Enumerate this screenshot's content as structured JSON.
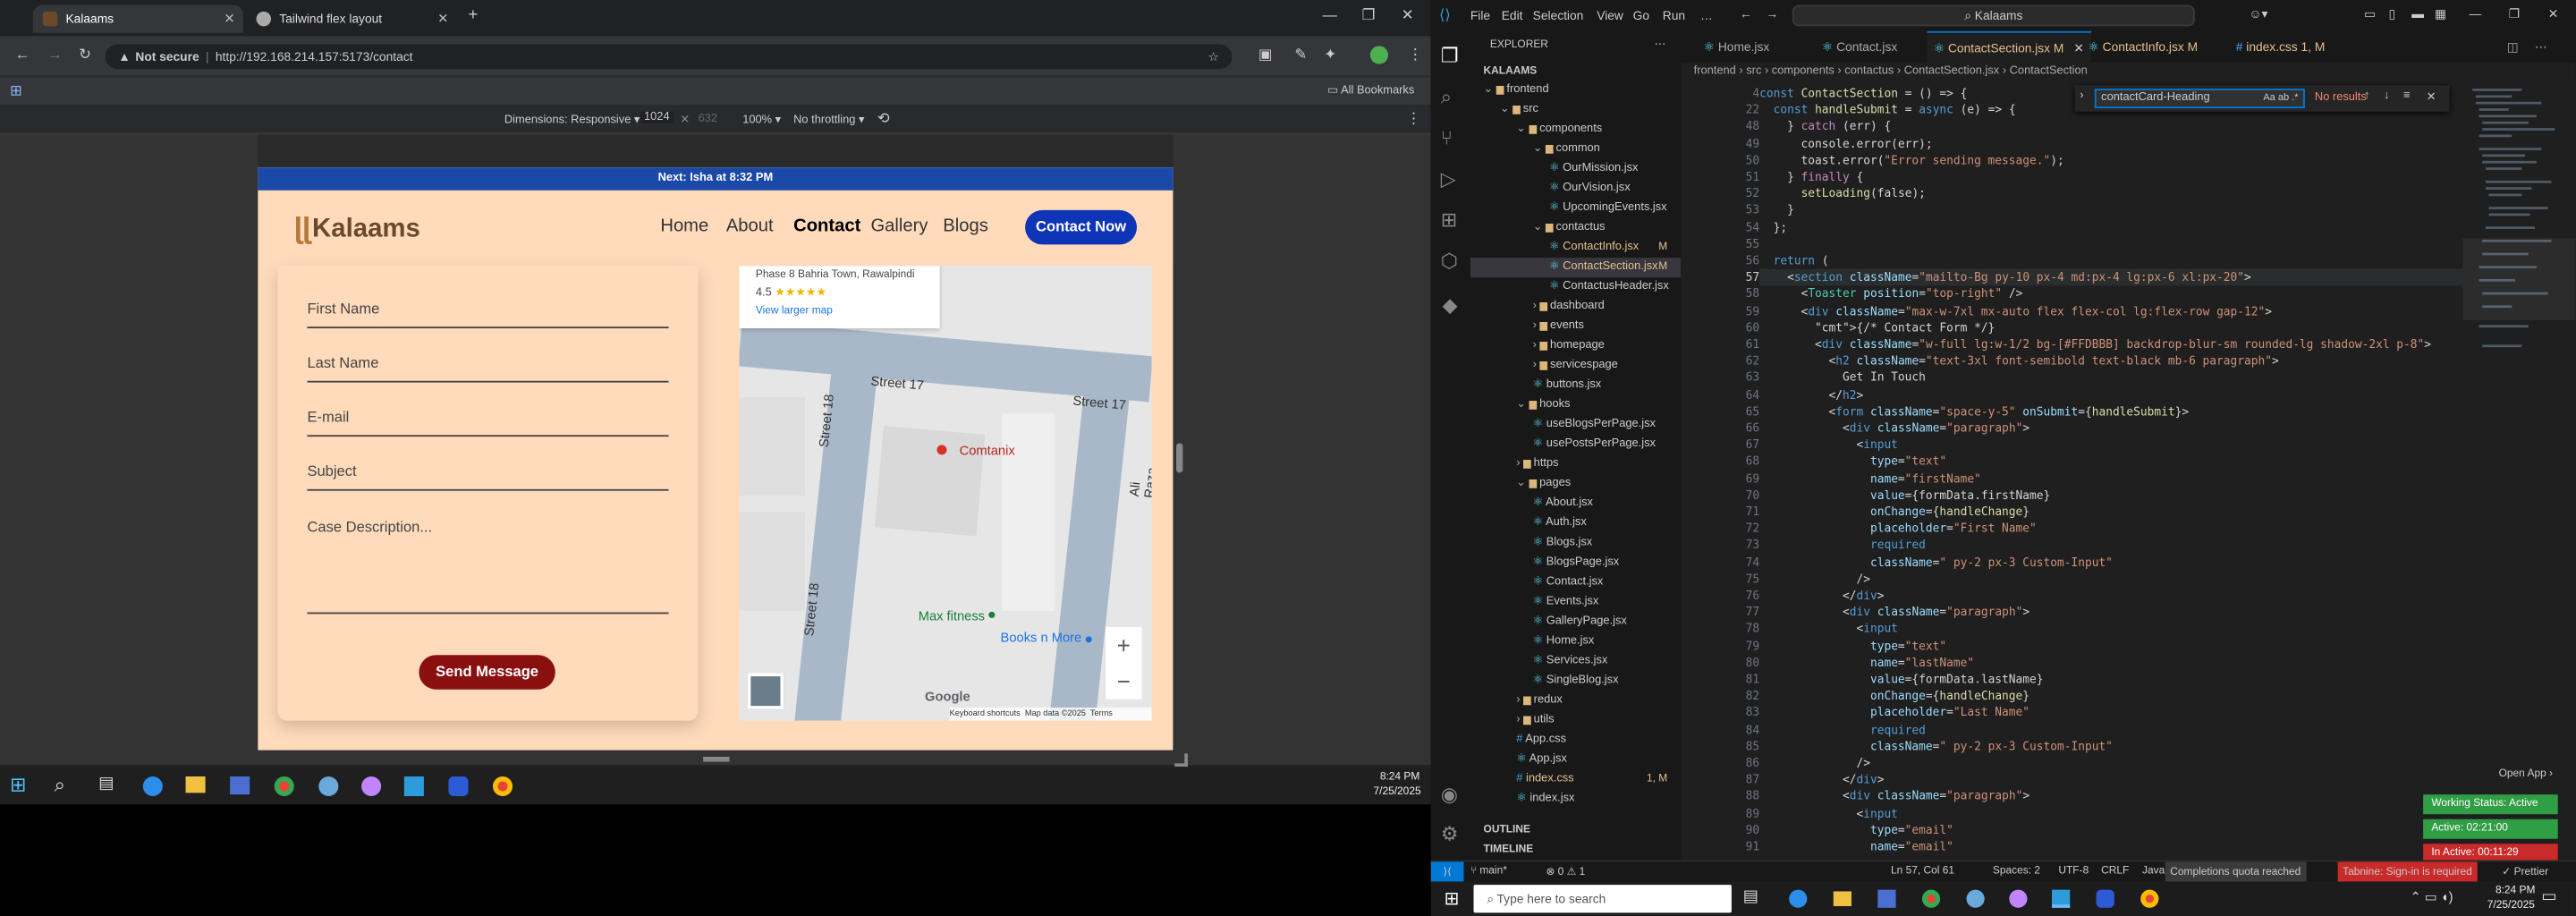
{
  "browser": {
    "tabs": [
      {
        "label": "Kalaams",
        "favicon_color": "#6b4a2a"
      },
      {
        "label": "Tailwind flex layout",
        "favicon_color": "#aaaaaa"
      }
    ],
    "not_secure": "Not secure",
    "url": "http://192.168.214.157:5173/contact",
    "all_bookmarks": "All Bookmarks",
    "devtools": {
      "dimensions": "Dimensions: Responsive ▾",
      "width": "1024",
      "height": "632",
      "zoom": "100% ▾",
      "throttle": "No throttling ▾"
    }
  },
  "site": {
    "announcement": "Next: Isha at 8:32 PM",
    "logo": "Kalaams",
    "nav": [
      "Home",
      "About",
      "Contact",
      "Gallery",
      "Blogs"
    ],
    "contact_button": "Contact Now",
    "form": {
      "fields": [
        "First Name",
        "Last Name",
        "E-mail",
        "Subject",
        "Case Description..."
      ],
      "submit": "Send Message"
    },
    "map": {
      "address": "Phase 8 Bahria Town, Rawalpindi",
      "rating": "4.5",
      "stars": "★★★★★",
      "larger_map": "View larger map",
      "labels": {
        "street1": "Street 17",
        "street2": "Street 17",
        "street3": "Street 18",
        "street4": "Street 18",
        "place": "Comtanix",
        "gym": "Max fitness",
        "books": "Books n More",
        "ali": "Ali Raza"
      },
      "google": "Google",
      "footer": [
        "Keyboard shortcuts",
        "Map data ©2025",
        "Terms"
      ]
    }
  },
  "taskbar_left": {
    "time": "8:24 PM",
    "date": "7/25/2025"
  },
  "vscode": {
    "menu": [
      "File",
      "Edit",
      "Selection",
      "View",
      "Go",
      "Run",
      "…"
    ],
    "search": "Kalaams",
    "explorer_title": "EXPLORER",
    "root": "KALAAMS",
    "tree": [
      {
        "label": "frontend",
        "indent": 0,
        "type": "folder",
        "open": true
      },
      {
        "label": "src",
        "indent": 1,
        "type": "folder",
        "open": true
      },
      {
        "label": "components",
        "indent": 2,
        "type": "folder",
        "open": true
      },
      {
        "label": "common",
        "indent": 3,
        "type": "folder",
        "open": true
      },
      {
        "label": "OurMission.jsx",
        "indent": 4,
        "type": "file"
      },
      {
        "label": "OurVision.jsx",
        "indent": 4,
        "type": "file"
      },
      {
        "label": "UpcomingEvents.jsx",
        "indent": 4,
        "type": "file"
      },
      {
        "label": "contactus",
        "indent": 3,
        "type": "folder",
        "open": true
      },
      {
        "label": "ContactInfo.jsx",
        "indent": 4,
        "type": "file",
        "mod": "M"
      },
      {
        "label": "ContactSection.jsx",
        "indent": 4,
        "type": "file",
        "mod": "M",
        "selected": true
      },
      {
        "label": "ContactusHeader.jsx",
        "indent": 4,
        "type": "file"
      },
      {
        "label": "dashboard",
        "indent": 3,
        "type": "folder"
      },
      {
        "label": "events",
        "indent": 3,
        "type": "folder"
      },
      {
        "label": "homepage",
        "indent": 3,
        "type": "folder"
      },
      {
        "label": "servicespage",
        "indent": 3,
        "type": "folder"
      },
      {
        "label": "buttons.jsx",
        "indent": 3,
        "type": "file"
      },
      {
        "label": "hooks",
        "indent": 2,
        "type": "folder",
        "open": true
      },
      {
        "label": "useBlogsPerPage.jsx",
        "indent": 3,
        "type": "file"
      },
      {
        "label": "usePostsPerPage.jsx",
        "indent": 3,
        "type": "file"
      },
      {
        "label": "https",
        "indent": 2,
        "type": "folder"
      },
      {
        "label": "pages",
        "indent": 2,
        "type": "folder",
        "open": true
      },
      {
        "label": "About.jsx",
        "indent": 3,
        "type": "file"
      },
      {
        "label": "Auth.jsx",
        "indent": 3,
        "type": "file"
      },
      {
        "label": "Blogs.jsx",
        "indent": 3,
        "type": "file"
      },
      {
        "label": "BlogsPage.jsx",
        "indent": 3,
        "type": "file"
      },
      {
        "label": "Contact.jsx",
        "indent": 3,
        "type": "file"
      },
      {
        "label": "Events.jsx",
        "indent": 3,
        "type": "file"
      },
      {
        "label": "GalleryPage.jsx",
        "indent": 3,
        "type": "file"
      },
      {
        "label": "Home.jsx",
        "indent": 3,
        "type": "file"
      },
      {
        "label": "Services.jsx",
        "indent": 3,
        "type": "file"
      },
      {
        "label": "SingleBlog.jsx",
        "indent": 3,
        "type": "file"
      },
      {
        "label": "redux",
        "indent": 2,
        "type": "folder"
      },
      {
        "label": "utils",
        "indent": 2,
        "type": "folder"
      },
      {
        "label": "App.css",
        "indent": 2,
        "type": "file"
      },
      {
        "label": "App.jsx",
        "indent": 2,
        "type": "file"
      },
      {
        "label": "index.css",
        "indent": 2,
        "type": "file",
        "mod": "1, M"
      },
      {
        "label": "index.jsx",
        "indent": 2,
        "type": "file"
      }
    ],
    "outline": "OUTLINE",
    "timeline": "TIMELINE",
    "editor_tabs": [
      {
        "label": "Home.jsx"
      },
      {
        "label": "Contact.jsx"
      },
      {
        "label": "ContactSection.jsx M",
        "active": true
      },
      {
        "label": "ContactInfo.jsx M"
      },
      {
        "label": "index.css 1, M"
      }
    ],
    "breadcrumb": "frontend › src › components › contactus › ContactSection.jsx › ContactSection",
    "find": {
      "query": "contactCard-Heading",
      "result": "No results"
    },
    "code_lines": [
      {
        "n": "4",
        "t": "const ContactSection = () => {"
      },
      {
        "n": "22",
        "t": "  const handleSubmit = async (e) => {"
      },
      {
        "n": "48",
        "t": "    } catch (err) {"
      },
      {
        "n": "49",
        "t": "      console.error(err);"
      },
      {
        "n": "50",
        "t": "      toast.error(\"Error sending message.\");"
      },
      {
        "n": "51",
        "t": "    } finally {"
      },
      {
        "n": "52",
        "t": "      setLoading(false);"
      },
      {
        "n": "53",
        "t": "    }"
      },
      {
        "n": "54",
        "t": "  };"
      },
      {
        "n": "55",
        "t": ""
      },
      {
        "n": "56",
        "t": "  return ("
      },
      {
        "n": "57",
        "t": "    <section className=\"mailto-Bg py-10 px-4 md:px-4 lg:px-6 xl:px-20\">"
      },
      {
        "n": "58",
        "t": "      <Toaster position=\"top-right\" />"
      },
      {
        "n": "59",
        "t": "      <div className=\"max-w-7xl mx-auto flex flex-col lg:flex-row gap-12\">"
      },
      {
        "n": "60",
        "t": "        {/* Contact Form */}"
      },
      {
        "n": "61",
        "t": "        <div className=\"w-full lg:w-1/2 bg-[#FFDBBB] backdrop-blur-sm rounded-lg shadow-2xl p-8\">"
      },
      {
        "n": "62",
        "t": "          <h2 className=\"text-3xl font-semibold text-black mb-6 paragraph\">"
      },
      {
        "n": "63",
        "t": "            Get In Touch"
      },
      {
        "n": "64",
        "t": "          </h2>"
      },
      {
        "n": "65",
        "t": "          <form className=\"space-y-5\" onSubmit={handleSubmit}>"
      },
      {
        "n": "66",
        "t": "            <div className=\"paragraph\">"
      },
      {
        "n": "67",
        "t": "              <input"
      },
      {
        "n": "68",
        "t": "                type=\"text\""
      },
      {
        "n": "69",
        "t": "                name=\"firstName\""
      },
      {
        "n": "70",
        "t": "                value={formData.firstName}"
      },
      {
        "n": "71",
        "t": "                onChange={handleChange}"
      },
      {
        "n": "72",
        "t": "                placeholder=\"First Name\""
      },
      {
        "n": "73",
        "t": "                required"
      },
      {
        "n": "74",
        "t": "                className=\" py-2 px-3 Custom-Input\""
      },
      {
        "n": "75",
        "t": "              />"
      },
      {
        "n": "76",
        "t": "            </div>"
      },
      {
        "n": "77",
        "t": "            <div className=\"paragraph\">"
      },
      {
        "n": "78",
        "t": "              <input"
      },
      {
        "n": "79",
        "t": "                type=\"text\""
      },
      {
        "n": "80",
        "t": "                name=\"lastName\""
      },
      {
        "n": "81",
        "t": "                value={formData.lastName}"
      },
      {
        "n": "82",
        "t": "                onChange={handleChange}"
      },
      {
        "n": "83",
        "t": "                placeholder=\"Last Name\""
      },
      {
        "n": "84",
        "t": "                required"
      },
      {
        "n": "85",
        "t": "                className=\" py-2 px-3 Custom-Input\""
      },
      {
        "n": "86",
        "t": "              />"
      },
      {
        "n": "87",
        "t": "            </div>"
      },
      {
        "n": "88",
        "t": "            <div className=\"paragraph\">"
      },
      {
        "n": "89",
        "t": "              <input"
      },
      {
        "n": "90",
        "t": "                type=\"email\""
      },
      {
        "n": "91",
        "t": "                name=\"email\""
      }
    ],
    "status": {
      "branch": "main*",
      "errors": "⊗ 0 ⚠ 1",
      "position": "Ln 57, Col 61",
      "spaces": "Spaces: 2",
      "encoding": "UTF-8",
      "eol": "CRLF",
      "lang": "JavaScript JSX",
      "quota": "Completions quota reached",
      "tabnine": "Tabnine: Sign-in is required",
      "prettier": "✓ Prettier"
    },
    "badges": {
      "open_app": "Open App ›",
      "working": "Working Status: Active",
      "active": "Active: 02:21:00",
      "inactive": "In Active: 00:11:29"
    }
  },
  "win_taskbar": {
    "search_placeholder": "Type here to search",
    "time": "8:24 PM",
    "date": "7/25/2025"
  }
}
